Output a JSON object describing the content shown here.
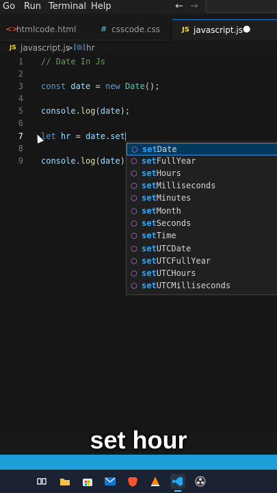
{
  "menu": {
    "go": "Go",
    "run": "Run",
    "terminal": "Terminal",
    "help": "Help",
    "back": "←",
    "forward": "→"
  },
  "tabs": [
    {
      "icon": "<>",
      "label": "htmlcode.html",
      "icon_color": "#e34c26"
    },
    {
      "icon": "#",
      "label": "csscode.css",
      "icon_color": "#519aba"
    },
    {
      "icon": "JS",
      "label": "javascript.js",
      "icon_color": "#f5de19",
      "dirty": "●"
    }
  ],
  "breadcrumb": {
    "file_icon": "JS",
    "file": "javascript.js",
    "sep": ">",
    "symbol_icon": "[◎]",
    "symbol": "hr"
  },
  "editor": {
    "line_numbers": [
      "1",
      "2",
      "3",
      "4",
      "5",
      "6",
      "7",
      "8",
      "9"
    ],
    "lines": {
      "l1": "// Date In Js",
      "l3a": "const",
      "l3b": "date",
      "l3c": "=",
      "l3d": "new",
      "l3e": "Date",
      "l3f": "();",
      "l5a": "console",
      "l5b": ".",
      "l5c": "log",
      "l5d": "(",
      "l5e": "date",
      "l5f": ");",
      "l7a": "let",
      "l7b": "hr",
      "l7c": "=",
      "l7d": "date",
      "l7e": ".",
      "l7f": "set",
      "l9a": "console",
      "l9b": ".",
      "l9c": "log",
      "l9d": "(",
      "l9e": "date",
      "l9f": ")"
    }
  },
  "suggestions": [
    {
      "match": "set",
      "rest": "Date"
    },
    {
      "match": "set",
      "rest": "FullYear"
    },
    {
      "match": "set",
      "rest": "Hours"
    },
    {
      "match": "set",
      "rest": "Milliseconds"
    },
    {
      "match": "set",
      "rest": "Minutes"
    },
    {
      "match": "set",
      "rest": "Month"
    },
    {
      "match": "set",
      "rest": "Seconds"
    },
    {
      "match": "set",
      "rest": "Time"
    },
    {
      "match": "set",
      "rest": "UTCDate"
    },
    {
      "match": "set",
      "rest": "UTCFullYear"
    },
    {
      "match": "set",
      "rest": "UTCHours"
    },
    {
      "match": "set",
      "rest": "UTCMilliseconds"
    }
  ],
  "caption": "set hour",
  "taskbar": [
    "task-view-icon",
    "file-explorer-icon",
    "store-icon",
    "mail-icon",
    "brave-icon",
    "vlc-icon",
    "vscode-icon",
    "obs-icon"
  ],
  "colors": {
    "accent": "#0078d4",
    "statusbar": "#1c9fd9",
    "suggest_match": "#2aaaff"
  }
}
